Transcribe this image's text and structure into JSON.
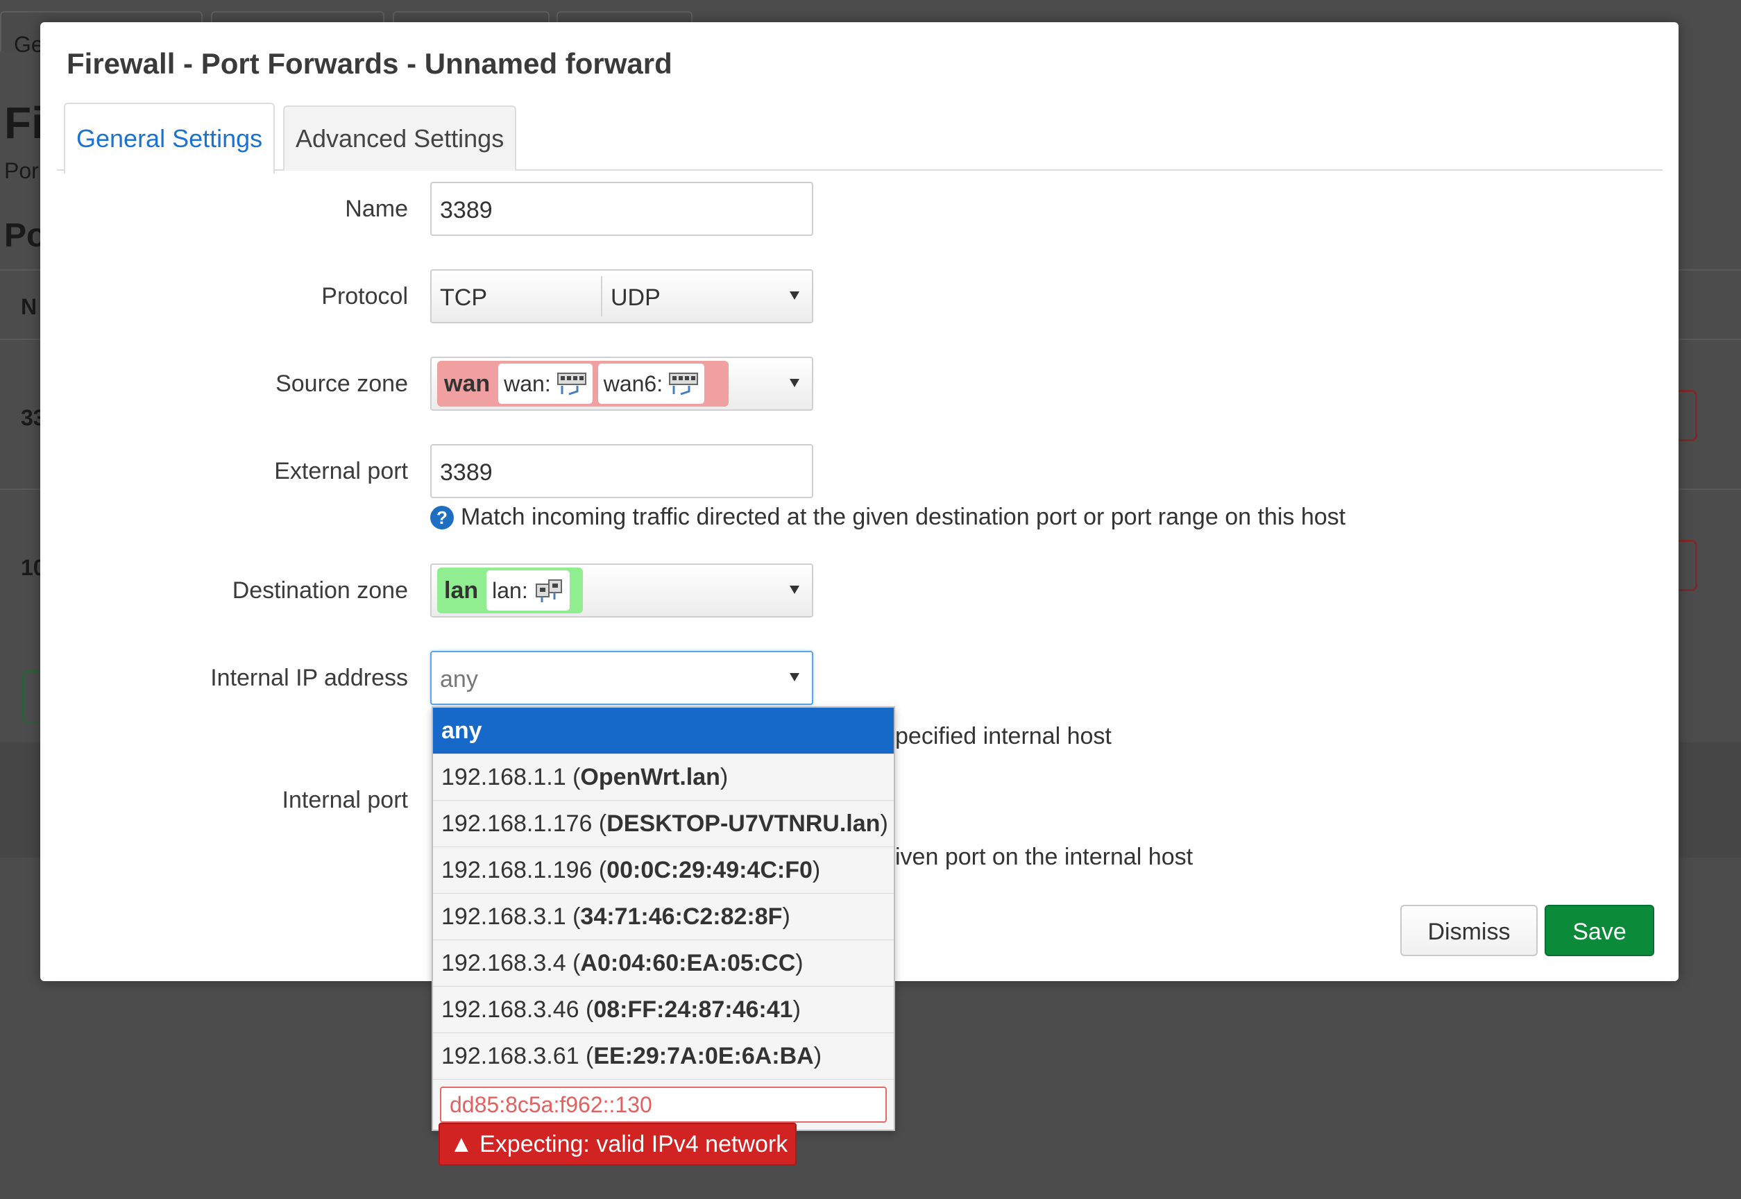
{
  "background": {
    "tabs": [
      "Ge",
      "",
      "",
      ""
    ],
    "title": "Fi",
    "subtitle": "Por",
    "section": "Po",
    "table_header": "N",
    "rows": [
      "33",
      "10"
    ]
  },
  "modal": {
    "title": "Firewall - Port Forwards - Unnamed forward",
    "tabs": [
      {
        "label": "General Settings",
        "active": true
      },
      {
        "label": "Advanced Settings",
        "active": false
      }
    ],
    "fields": {
      "name": {
        "label": "Name",
        "value": "3389"
      },
      "protocol": {
        "label": "Protocol",
        "values": [
          "TCP",
          "UDP"
        ]
      },
      "source_zone": {
        "label": "Source zone",
        "zone": "wan",
        "zone_color": "#f0a0a0",
        "interfaces": [
          "wan:",
          "wan6:"
        ]
      },
      "external_port": {
        "label": "External port",
        "value": "3389",
        "help": "Match incoming traffic directed at the given destination port or port range on this host"
      },
      "destination_zone": {
        "label": "Destination zone",
        "zone": "lan",
        "zone_color": "#90ee90",
        "interfaces": [
          "lan:"
        ]
      },
      "internal_ip": {
        "label": "Internal IP address",
        "value": "any",
        "help_partial": "pecified internal host"
      },
      "internal_port": {
        "label": "Internal port",
        "help_partial": "iven port on the internal host"
      }
    },
    "buttons": {
      "dismiss": "Dismiss",
      "save": "Save"
    }
  },
  "dropdown": {
    "options": [
      {
        "ip": "any",
        "host": ""
      },
      {
        "ip": "192.168.1.1",
        "host": "OpenWrt.lan"
      },
      {
        "ip": "192.168.1.176",
        "host": "DESKTOP-U7VTNRU.lan"
      },
      {
        "ip": "192.168.1.196",
        "host": "00:0C:29:49:4C:F0"
      },
      {
        "ip": "192.168.3.1",
        "host": "34:71:46:C2:82:8F"
      },
      {
        "ip": "192.168.3.4",
        "host": "A0:04:60:EA:05:CC"
      },
      {
        "ip": "192.168.3.46",
        "host": "08:FF:24:87:46:41"
      },
      {
        "ip": "192.168.3.61",
        "host": "EE:29:7A:0E:6A:BA"
      }
    ],
    "custom_value": "dd85:8c5a:f962::130",
    "error": "Expecting: valid IPv4 network"
  },
  "colors": {
    "accent": "#1668c9",
    "save": "#0b8a3a",
    "error": "#d22323"
  }
}
